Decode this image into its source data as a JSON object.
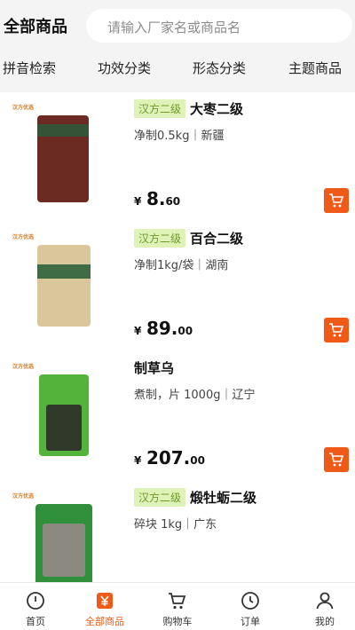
{
  "header": {
    "title": "全部商品",
    "search_placeholder": "请输入厂家名或商品名"
  },
  "categories": [
    "拼音检索",
    "功效分类",
    "形态分类",
    "主题商品"
  ],
  "products": [
    {
      "badge": "汉方二级",
      "name": "大枣二级",
      "spec": "净制0.5kg｜新疆",
      "price_yen": "¥",
      "price_int": "8.",
      "price_dec": "60",
      "brand": "汉方优选",
      "bag_color": "#6b2a22",
      "band_color": "#2c5a3a"
    },
    {
      "badge": "汉方二级",
      "name": "百合二级",
      "spec": "净制1kg/袋｜湖南",
      "price_yen": "¥",
      "price_int": "89.",
      "price_dec": "00",
      "brand": "汉方优选",
      "bag_color": "#d9c79b",
      "band_color": "#3f6b45"
    },
    {
      "badge": "",
      "name": "制草乌",
      "spec": "煮制，片 1000g｜辽宁",
      "price_yen": "¥",
      "price_int": "207.",
      "price_dec": "00",
      "brand": "汉方优选",
      "bag_color": "#2f3a2a",
      "band_color": "#54b33a"
    },
    {
      "badge": "汉方二级",
      "name": "煅牡蛎二级",
      "spec": "碎块 1kg｜广东",
      "price_yen": "¥",
      "price_int": "",
      "price_dec": "",
      "brand": "汉方优选",
      "bag_color": "#8c8a80",
      "band_color": "#2f8f3a"
    }
  ],
  "bottom_nav": [
    {
      "label": "首页",
      "icon": "home-icon"
    },
    {
      "label": "全部商品",
      "icon": "all-products-icon",
      "active": true
    },
    {
      "label": "购物车",
      "icon": "cart-icon"
    },
    {
      "label": "订单",
      "icon": "orders-icon"
    },
    {
      "label": "我的",
      "icon": "profile-icon"
    }
  ],
  "colors": {
    "accent": "#ef5a18",
    "badge_bg": "#dff3b9",
    "badge_text": "#6f9a2c"
  }
}
